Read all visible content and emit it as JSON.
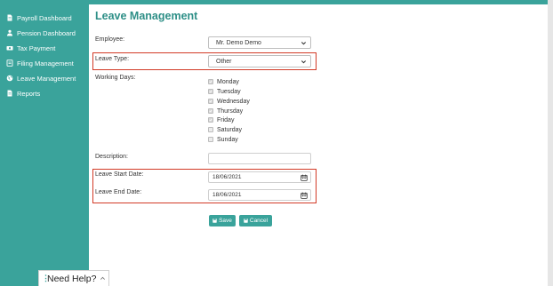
{
  "colors": {
    "teal": "#3aa39b",
    "title": "#2e8f87",
    "highlight": "#d23a26"
  },
  "sidebar": {
    "items": [
      {
        "label": "Payroll Dashboard",
        "icon": "document-icon"
      },
      {
        "label": "Pension Dashboard",
        "icon": "person-icon"
      },
      {
        "label": "Tax Payment",
        "icon": "money-icon"
      },
      {
        "label": "Filing Management",
        "icon": "file-icon"
      },
      {
        "label": "Leave Management",
        "icon": "globe-icon"
      },
      {
        "label": "Reports",
        "icon": "document-icon"
      }
    ]
  },
  "page": {
    "title": "Leave Management"
  },
  "form": {
    "employee_label": "Employee:",
    "employee_value": "Mr. Demo Demo",
    "leave_type_label": "Leave Type:",
    "leave_type_value": "Other",
    "working_days_label": "Working Days:",
    "days": [
      {
        "label": "Monday",
        "checked": true
      },
      {
        "label": "Tuesday",
        "checked": true
      },
      {
        "label": "Wednesday",
        "checked": true
      },
      {
        "label": "Thursday",
        "checked": true
      },
      {
        "label": "Friday",
        "checked": true
      },
      {
        "label": "Saturday",
        "checked": false
      },
      {
        "label": "Sunday",
        "checked": false
      }
    ],
    "description_label": "Description:",
    "description_value": "",
    "start_label": "Leave Start Date:",
    "start_value": "18/06/2021",
    "end_label": "Leave End Date:",
    "end_value": "18/06/2021",
    "save_label": "Save",
    "cancel_label": "Cancel"
  },
  "help": {
    "label": "Need Help?"
  }
}
